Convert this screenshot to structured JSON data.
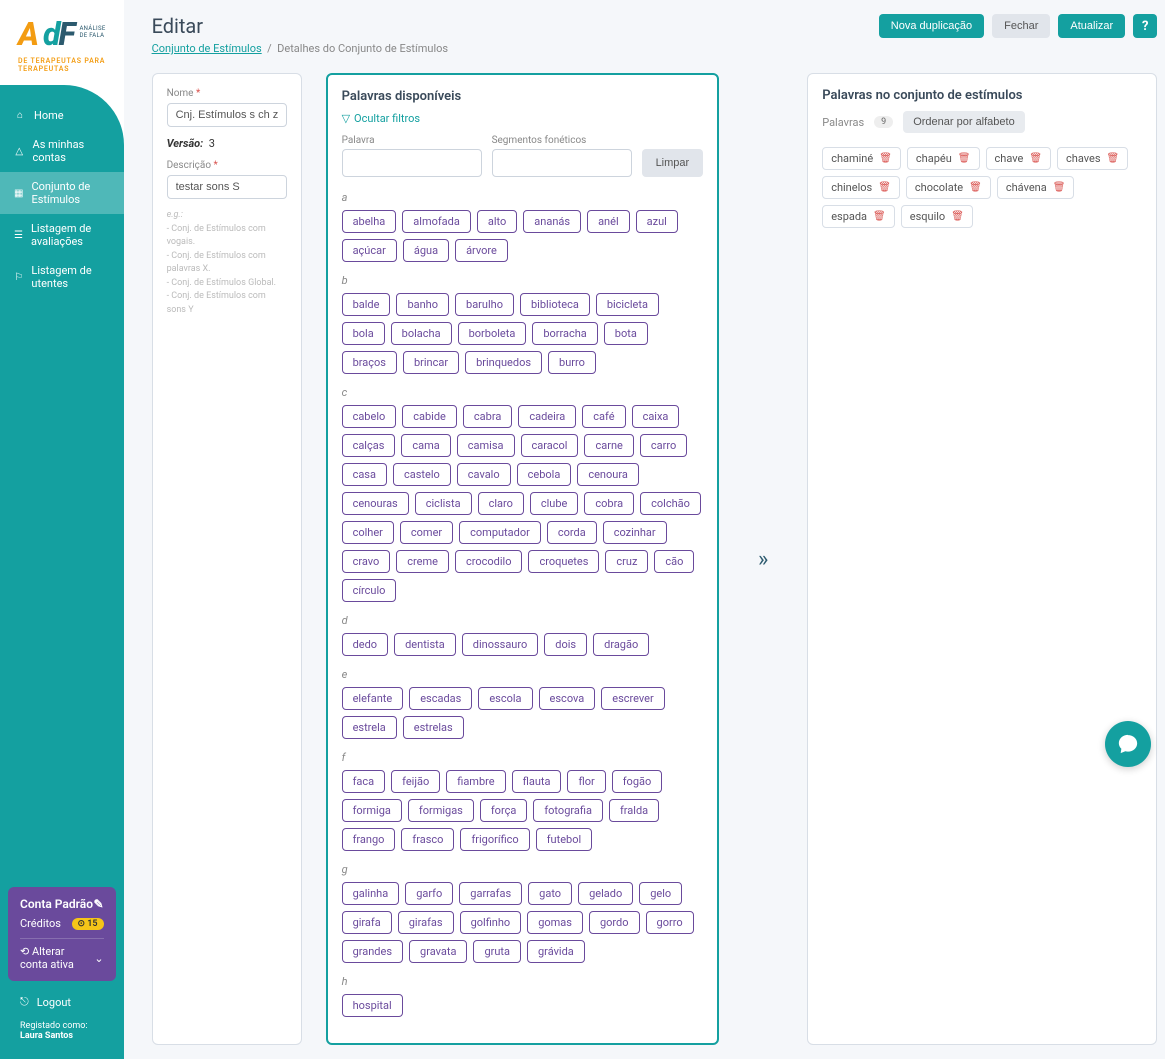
{
  "logo": {
    "sub1": "ANÁLISE",
    "sub2": "DE FALA",
    "tagline": "DE TERAPEUTAS PARA TERAPEUTAS"
  },
  "nav": {
    "home": "Home",
    "accounts": "As minhas contas",
    "stimuli": "Conjunto de Estímulos",
    "evals": "Listagem de avaliações",
    "clients": "Listagem de utentes"
  },
  "account": {
    "title": "Conta Padrão",
    "credits_label": "Créditos",
    "credits_value": "⊙ 15",
    "switch": "Alterar conta ativa"
  },
  "logout": "Logout",
  "registered": {
    "prefix": "Registado como:",
    "name": "Laura Santos"
  },
  "header": {
    "title": "Editar",
    "crumb1": "Conjunto de Estímulos",
    "crumb2": "Detalhes do Conjunto de Estímulos",
    "btn_dup": "Nova duplicação",
    "btn_close": "Fechar",
    "btn_update": "Atualizar",
    "btn_help": "?"
  },
  "form": {
    "name_label": "Nome",
    "name_value": "Cnj. Estímulos s ch z",
    "version_label": "Versão:",
    "version_value": "3",
    "desc_label": "Descrição",
    "desc_value": "testar sons S",
    "hint_title": "e.g.:",
    "hint1": "- Conj. de Estímulos com vogais.",
    "hint2": "- Conj. de Estímulos com palavras X.",
    "hint3": "- Conj. de Estímulos Global.",
    "hint4": "- Conj. de Estímulos com sons Y"
  },
  "avail": {
    "title": "Palavras disponíveis",
    "hide_filters": "Ocultar filtros",
    "word_label": "Palavra",
    "seg_label": "Segmentos fonéticos",
    "clear": "Limpar",
    "sections": [
      {
        "letter": "a",
        "words": [
          "abelha",
          "almofada",
          "alto",
          "ananás",
          "anél",
          "azul",
          "açúcar",
          "água",
          "árvore"
        ]
      },
      {
        "letter": "b",
        "words": [
          "balde",
          "banho",
          "barulho",
          "biblioteca",
          "bicicleta",
          "bola",
          "bolacha",
          "borboleta",
          "borracha",
          "bota",
          "braços",
          "brincar",
          "brinquedos",
          "burro"
        ]
      },
      {
        "letter": "c",
        "words": [
          "cabelo",
          "cabide",
          "cabra",
          "cadeira",
          "café",
          "caixa",
          "calças",
          "cama",
          "camisa",
          "caracol",
          "carne",
          "carro",
          "casa",
          "castelo",
          "cavalo",
          "cebola",
          "cenoura",
          "cenouras",
          "ciclista",
          "claro",
          "clube",
          "cobra",
          "colchão",
          "colher",
          "comer",
          "computador",
          "corda",
          "cozinhar",
          "cravo",
          "creme",
          "crocodilo",
          "croquetes",
          "cruz",
          "cão",
          "círculo"
        ]
      },
      {
        "letter": "d",
        "words": [
          "dedo",
          "dentista",
          "dinossauro",
          "dois",
          "dragão"
        ]
      },
      {
        "letter": "e",
        "words": [
          "elefante",
          "escadas",
          "escola",
          "escova",
          "escrever",
          "estrela",
          "estrelas"
        ]
      },
      {
        "letter": "f",
        "words": [
          "faca",
          "feijão",
          "fiambre",
          "flauta",
          "flor",
          "fogão",
          "formiga",
          "formigas",
          "força",
          "fotografia",
          "fralda",
          "frango",
          "frasco",
          "frigorífico",
          "futebol"
        ]
      },
      {
        "letter": "g",
        "words": [
          "galinha",
          "garfo",
          "garrafas",
          "gato",
          "gelado",
          "gelo",
          "girafa",
          "girafas",
          "golfinho",
          "gomas",
          "gordo",
          "gorro",
          "grandes",
          "gravata",
          "gruta",
          "grávida"
        ]
      },
      {
        "letter": "h",
        "words": [
          "hospital"
        ]
      }
    ]
  },
  "selected": {
    "title": "Palavras no conjunto de estímulos",
    "count_label": "Palavras",
    "count": "9",
    "sort": "Ordenar por alfabeto",
    "words": [
      "chaminé",
      "chapéu",
      "chave",
      "chaves",
      "chinelos",
      "chocolate",
      "chávena",
      "espada",
      "esquilo"
    ]
  }
}
